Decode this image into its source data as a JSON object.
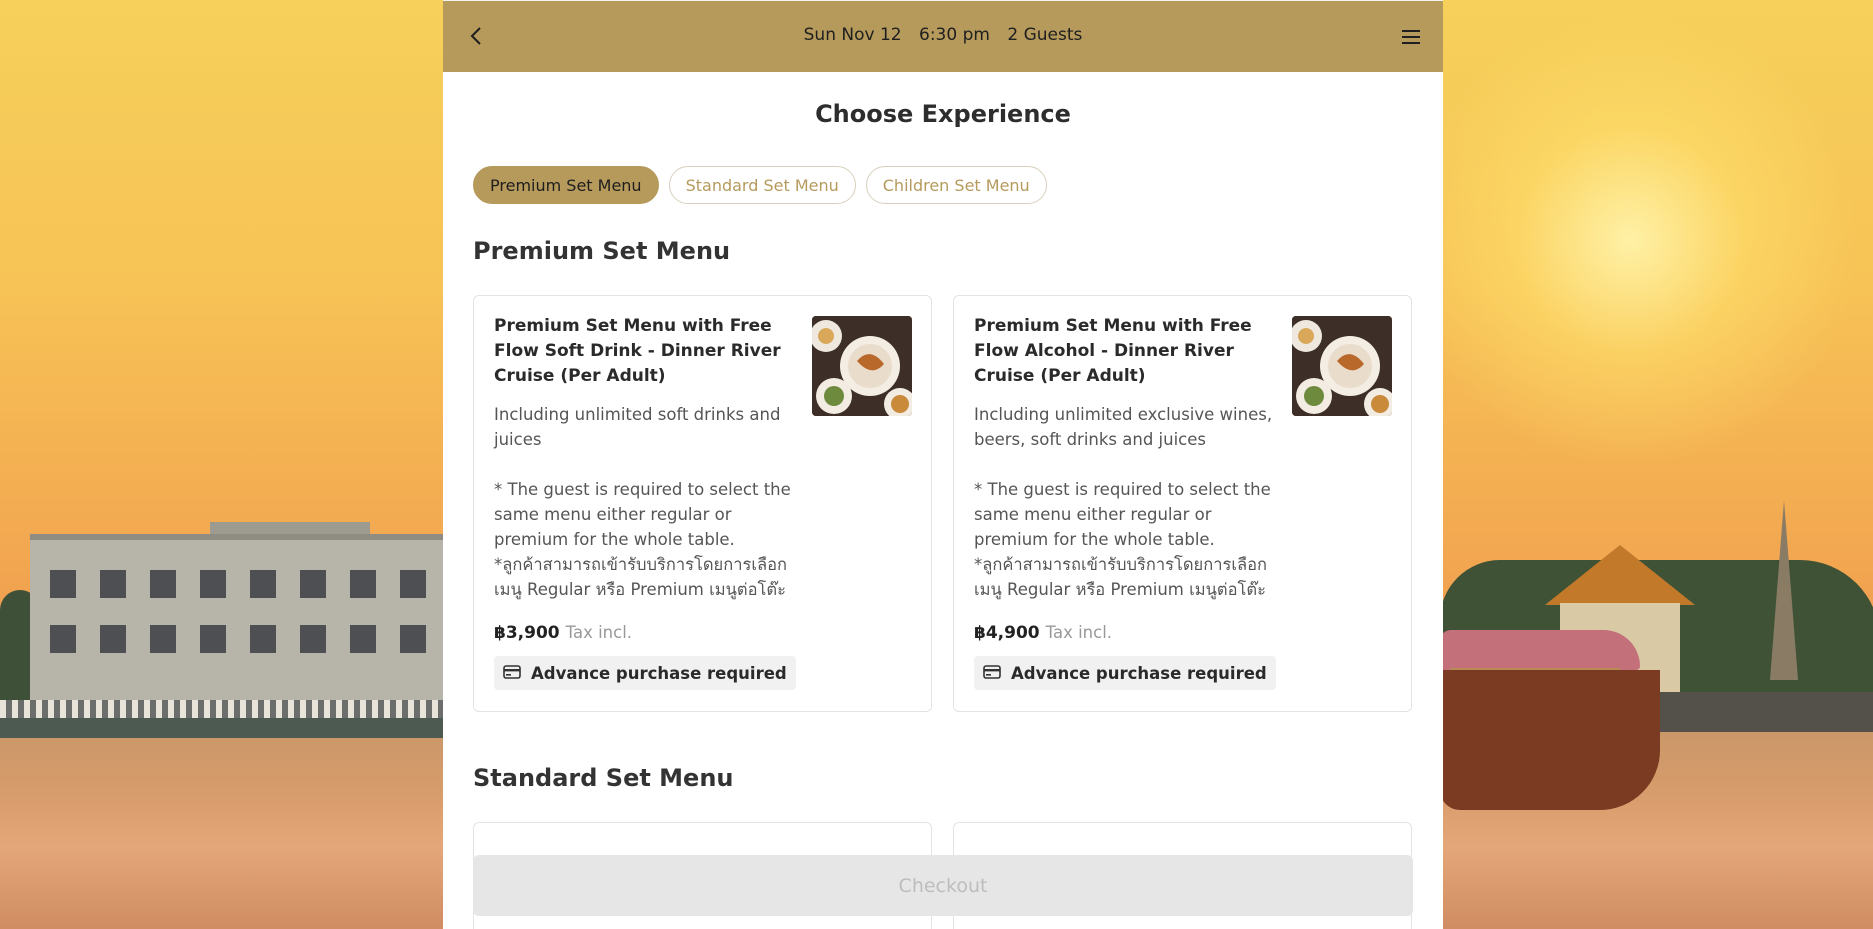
{
  "topbar": {
    "date": "Sun Nov 12",
    "time": "6:30 pm",
    "guests": "2 Guests",
    "back_icon": "chevron-left-icon",
    "menu_icon": "hamburger-menu-icon",
    "color": "#b59a5c"
  },
  "page_title": "Choose Experience",
  "tabs": [
    {
      "label": "Premium Set Menu",
      "active": true
    },
    {
      "label": "Standard Set Menu",
      "active": false
    },
    {
      "label": "Children Set Menu",
      "active": false
    }
  ],
  "sections": [
    {
      "title": "Premium Set Menu",
      "cards": [
        {
          "name": "Premium Set Menu with Free Flow Soft Drink - Dinner River Cruise (Per Adult)",
          "description": "Including unlimited soft drinks and juices\n\n* The guest is required to select the same menu either regular or premium for the whole table.\n*ลูกค้าสามารถเข้ารับบริการโดยการเลือกเมนู Regular หรือ Premium เมนูต่อโต๊ะ",
          "price": "฿3,900",
          "tax_note": "Tax incl.",
          "badge": "Advance purchase required",
          "badge_icon": "credit-card-icon"
        },
        {
          "name": "Premium Set Menu with Free Flow Alcohol - Dinner River Cruise (Per Adult)",
          "description": "Including unlimited exclusive wines, beers, soft drinks and juices\n\n* The guest is required to select the same menu either regular or premium for the whole table.\n*ลูกค้าสามารถเข้ารับบริการโดยการเลือกเมนู Regular หรือ Premium เมนูต่อโต๊ะ",
          "price": "฿4,900",
          "tax_note": "Tax incl.",
          "badge": "Advance purchase required",
          "badge_icon": "credit-card-icon"
        }
      ]
    },
    {
      "title": "Standard Set Menu",
      "cards": []
    }
  ],
  "checkout": {
    "label": "Checkout",
    "disabled": true
  }
}
